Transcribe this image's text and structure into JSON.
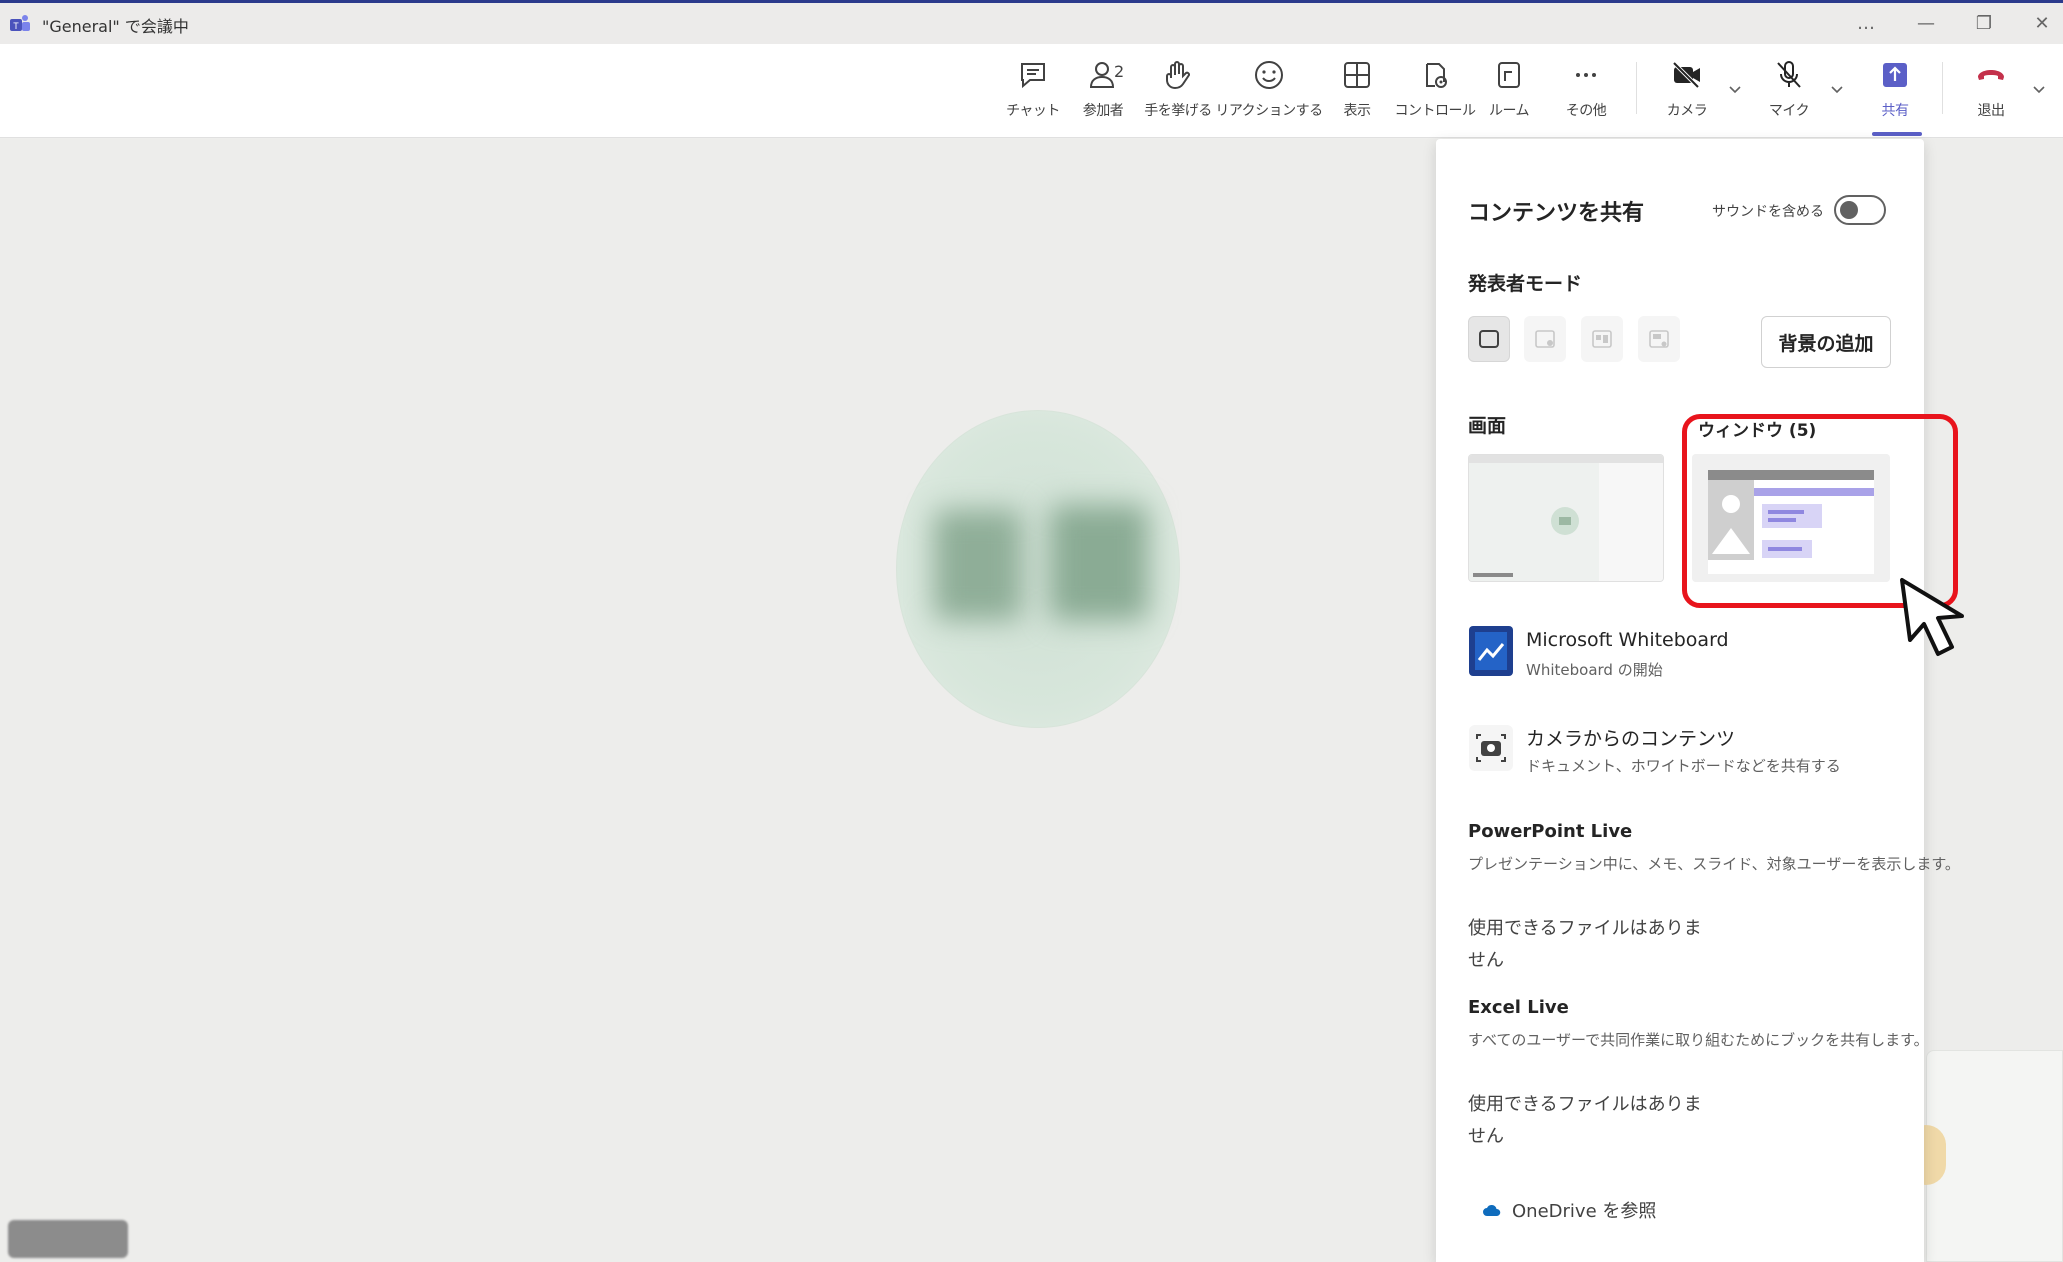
{
  "window": {
    "title": "\"General\" で会議中",
    "controls": {
      "more": "…",
      "minimize": "—",
      "restore": "❐",
      "close": "✕"
    }
  },
  "toolbar": {
    "chat": "チャット",
    "people": "参加者",
    "people_count": "2",
    "raise_hand": "手を挙げる",
    "react": "リアクションする",
    "view": "表示",
    "control": "コントロール",
    "rooms": "ルーム",
    "more": "その他",
    "camera": "カメラ",
    "mic": "マイク",
    "share": "共有",
    "leave": "退出"
  },
  "share_panel": {
    "title": "コンテンツを共有",
    "include_sound": "サウンドを含める",
    "presenter_mode": "発表者モード",
    "add_background": "背景の追加",
    "screen_heading": "画面",
    "window_heading": "ウィンドウ (5)",
    "whiteboard_title": "Microsoft Whiteboard",
    "whiteboard_sub": "Whiteboard の開始",
    "camera_content_title": "カメラからのコンテンツ",
    "camera_content_sub": "ドキュメント、ホワイトボードなどを共有する",
    "ppt_title": "PowerPoint Live",
    "ppt_sub": "プレゼンテーション中に、メモ、スライド、対象ユーザーを表示します。",
    "ppt_none": "使用できるファイルはありません",
    "excel_title": "Excel Live",
    "excel_sub": "すべてのユーザーで共同作業に取り組むためにブックを共有します。",
    "excel_none": "使用できるファイルはありません",
    "onedrive": "OneDrive を参照"
  },
  "colors": {
    "accent": "#5b5fc7",
    "leave": "#c4314b",
    "highlight": "#e8141c"
  }
}
